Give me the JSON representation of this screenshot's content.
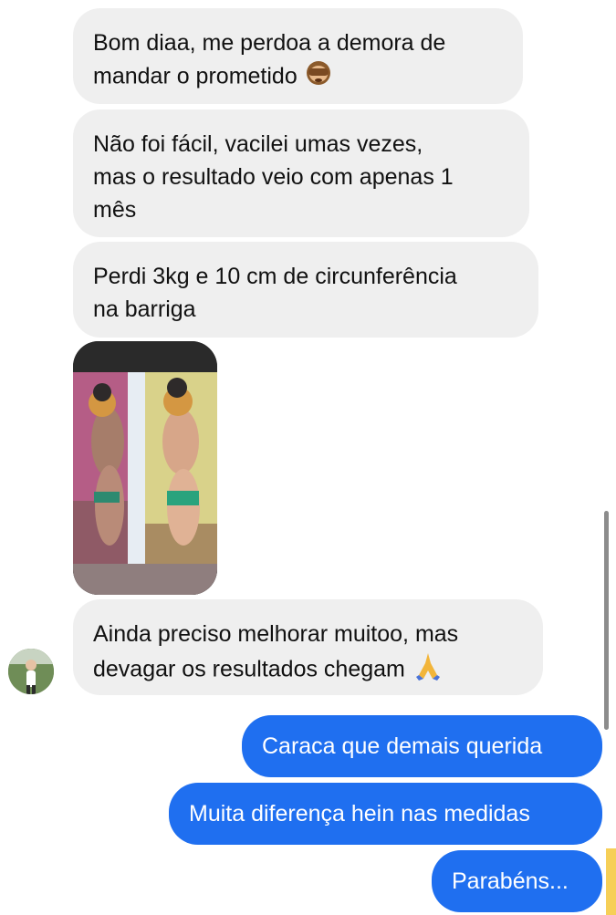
{
  "conversation": {
    "messages": [
      {
        "lines": [
          "Bom diaa, me perdoa a demora de",
          "mandar o prometido"
        ],
        "trailing_icon": "see-no-evil-monkey-icon"
      },
      {
        "lines": [
          "Não foi fácil, vacilei umas vezes,",
          "mas o resultado veio com apenas 1",
          "mês"
        ]
      },
      {
        "lines": [
          "Perdi 3kg e 10 cm de circunferência",
          "na barriga"
        ]
      },
      {
        "type": "image",
        "icon": "before-after-photo"
      },
      {
        "lines": [
          "Ainda preciso melhorar muitoo, mas",
          "devagar os resultados chegam"
        ],
        "trailing_icon": "folded-hands-icon"
      },
      {
        "text": "Caraca que demais querida"
      },
      {
        "text": "Muita diferença hein nas medidas"
      },
      {
        "text": "Parabéns..."
      }
    ]
  },
  "colors": {
    "incoming_bubble": "#efefef",
    "outgoing_bubble": "#1f6ff0",
    "text_dark": "#111111",
    "text_light": "#ffffff",
    "background": "#ffffff"
  }
}
